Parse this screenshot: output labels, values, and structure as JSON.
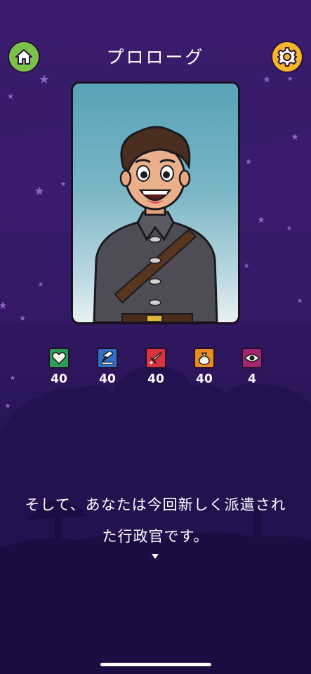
{
  "header": {
    "title": "プロローグ",
    "home_icon": "home-icon",
    "settings_icon": "gear-icon"
  },
  "stats": [
    {
      "icon": "heart-icon",
      "value": "40",
      "color": "#2e9b57"
    },
    {
      "icon": "gavel-icon",
      "value": "40",
      "color": "#2f6fc9"
    },
    {
      "icon": "sword-icon",
      "value": "40",
      "color": "#d8333e"
    },
    {
      "icon": "money-bag-icon",
      "value": "40",
      "color": "#e98a22"
    },
    {
      "icon": "eye-icon",
      "value": "4",
      "color": "#a3246f"
    }
  ],
  "dialog": {
    "line1": "そして、あなたは今回新しく派遣され",
    "line2": "た行政官です。"
  },
  "colors": {
    "background": "#341a66",
    "home_button": "#7bc24a",
    "settings_button": "#f3b52a"
  }
}
